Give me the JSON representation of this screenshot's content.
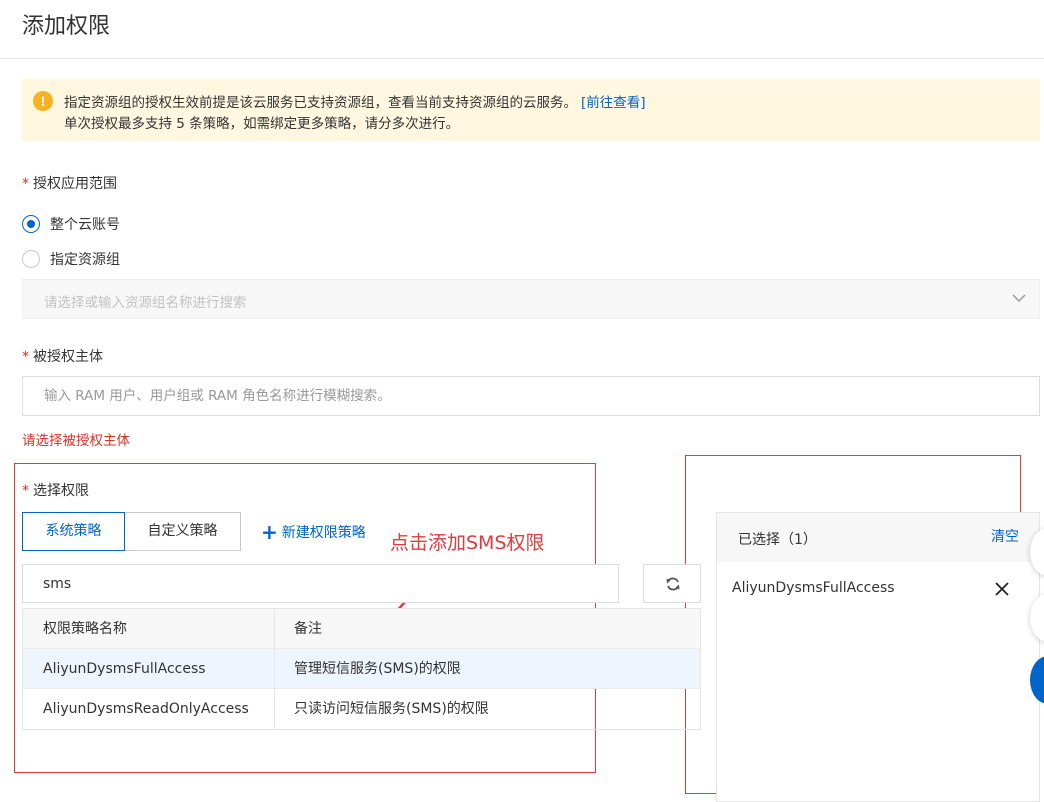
{
  "page": {
    "title": "添加权限"
  },
  "alert": {
    "icon": "warning-icon",
    "line1": "指定资源组的授权生效前提是该云服务已支持资源组，查看当前支持资源组的云服务。",
    "link": "[前往查看]",
    "line2": "单次授权最多支持 5 条策略，如需绑定更多策略，请分多次进行。"
  },
  "scope": {
    "required_mark": "*",
    "label": "授权应用范围",
    "options": [
      {
        "label": "整个云账号",
        "checked": true
      },
      {
        "label": "指定资源组",
        "checked": false
      }
    ],
    "resource_group_placeholder": "请选择或输入资源组名称进行搜索"
  },
  "principal": {
    "required_mark": "*",
    "label": "被授权主体",
    "placeholder": "输入 RAM 用户、用户组或 RAM 角色名称进行模糊搜索。",
    "error": "请选择被授权主体"
  },
  "permissions": {
    "required_mark": "*",
    "label": "选择权限",
    "tabs": [
      {
        "label": "系统策略",
        "active": true
      },
      {
        "label": "自定义策略",
        "active": false
      }
    ],
    "new_policy_plus": "+",
    "new_policy_label": "新建权限策略",
    "search_value": "sms",
    "table": {
      "headers": [
        "权限策略名称",
        "备注"
      ],
      "rows": [
        {
          "name": "AliyunDysmsFullAccess",
          "note": "管理短信服务(SMS)的权限",
          "highlighted": true
        },
        {
          "name": "AliyunDysmsReadOnlyAccess",
          "note": "只读访问短信服务(SMS)的权限",
          "highlighted": false
        }
      ]
    }
  },
  "selected": {
    "title": "已选择（1）",
    "clear_label": "清空",
    "items": [
      "AliyunDysmsFullAccess"
    ]
  },
  "annotation": {
    "text": "点击添加SMS权限"
  },
  "colors": {
    "primary": "#0064c8",
    "required": "#d93026",
    "alert_bg": "#fff7e0",
    "alert_icon": "#f5b324",
    "annotation_red": "#e0393e",
    "row_highlight": "#eef5fd"
  }
}
